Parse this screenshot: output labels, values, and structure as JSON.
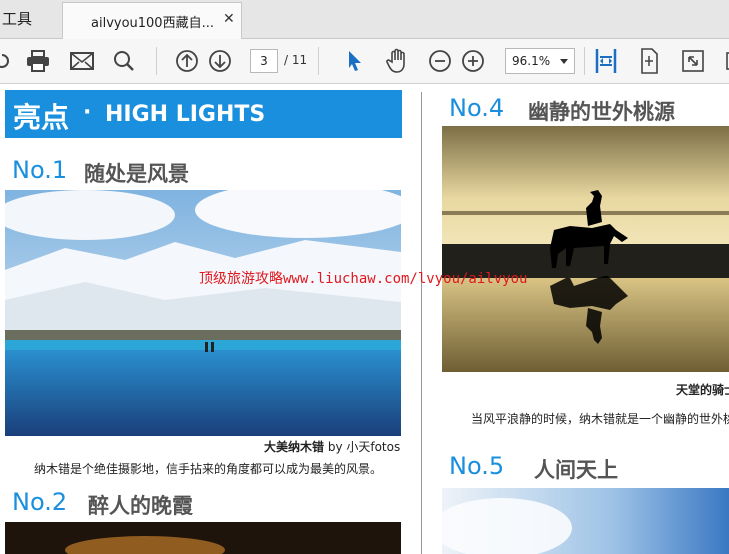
{
  "tabs": {
    "tools": "工具",
    "document": "ailvyou100西藏自..."
  },
  "icons": {
    "close": "close-icon",
    "print": "print-icon",
    "mail": "mail-icon",
    "search": "search-icon",
    "prev": "arrow-up-icon",
    "next": "arrow-down-icon",
    "select": "cursor-icon",
    "hand": "hand-icon",
    "zoom_out": "zoom-out-icon",
    "zoom_in": "zoom-in-icon",
    "fit_width": "fit-width-icon",
    "fit_page": "fit-page-icon",
    "fullscreen": "fullscreen-icon"
  },
  "toolbar": {
    "page_current": "3",
    "page_total": "/ 11",
    "zoom": "96.1%"
  },
  "colors": {
    "accent": "#1a8fde",
    "watermark": "#e0191f"
  },
  "document": {
    "highlight_banner": {
      "cn": "亮点",
      "dot": "·",
      "en": "HIGH LIGHTS"
    },
    "sections": [
      {
        "num": "No.1",
        "title": "随处是风景",
        "caption_bold": "大美纳木错",
        "caption_rest": " by 小天fotos",
        "text": "纳木错是个绝佳摄影地，信手拈来的角度都可以成为最美的风景。"
      },
      {
        "num": "No.2",
        "title": "醉人的晚霞"
      },
      {
        "num": "No.4",
        "title": "幽静的世外桃源",
        "caption_bold": "天堂的骑士",
        "text": "当风平浪静的时候，纳木错就是一个幽静的世外桃"
      },
      {
        "num": "No.5",
        "title": "人间天上"
      }
    ],
    "watermark": "顶级旅游攻略www.liuchaw.com/lvyou/ailvyou"
  }
}
